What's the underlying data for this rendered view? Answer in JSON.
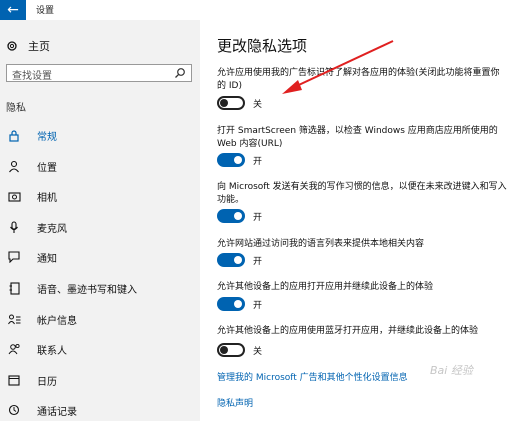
{
  "window": {
    "title": "设置"
  },
  "sidebar": {
    "home_label": "主页",
    "search_placeholder": "查找设置",
    "section_label": "隐私",
    "items": [
      {
        "label": "常规",
        "icon": "lock-icon",
        "active": true
      },
      {
        "label": "位置",
        "icon": "person-location-icon"
      },
      {
        "label": "相机",
        "icon": "camera-icon"
      },
      {
        "label": "麦克风",
        "icon": "microphone-icon"
      },
      {
        "label": "通知",
        "icon": "chat-bubble-icon"
      },
      {
        "label": "语音、墨迹书写和键入",
        "icon": "notebook-icon"
      },
      {
        "label": "帐户信息",
        "icon": "account-info-icon"
      },
      {
        "label": "联系人",
        "icon": "people-icon"
      },
      {
        "label": "日历",
        "icon": "calendar-icon"
      },
      {
        "label": "通话记录",
        "icon": "history-icon"
      }
    ]
  },
  "main": {
    "title": "更改隐私选项",
    "options": [
      {
        "text": "允许应用使用我的广告标识符了解对各应用的体验(关闭此功能将重置你的 ID)",
        "state": "关",
        "on": false
      },
      {
        "text": "打开 SmartScreen 筛选器，以检查 Windows 应用商店应用所使用的 Web 内容(URL)",
        "state": "开",
        "on": true
      },
      {
        "text": "向 Microsoft 发送有关我的写作习惯的信息，以便在未来改进键入和写入功能。",
        "state": "开",
        "on": true
      },
      {
        "text": "允许网站通过访问我的语言列表来提供本地相关内容",
        "state": "开",
        "on": true
      },
      {
        "text": "允许其他设备上的应用打开应用并继续此设备上的体验",
        "state": "开",
        "on": true
      },
      {
        "text": "允许其他设备上的应用使用蓝牙打开应用，并继续此设备上的体验",
        "state": "关",
        "on": false
      }
    ],
    "link_manage": "管理我的 Microsoft 广告和其他个性化设置信息",
    "link_privacy": "隐私声明"
  },
  "watermark": "Bai 经验"
}
